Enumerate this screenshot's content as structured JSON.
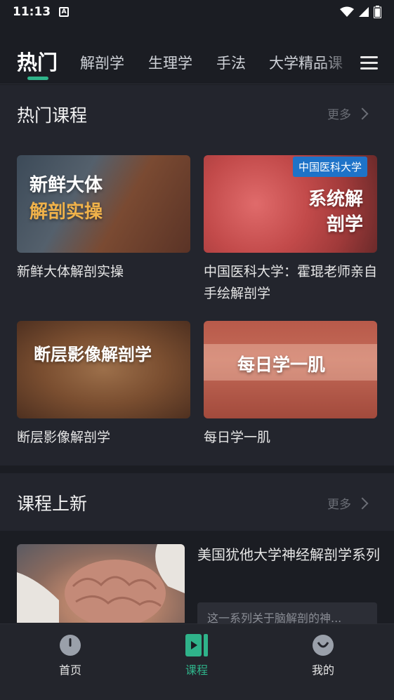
{
  "status_bar": {
    "time": "11:13",
    "notification_icon": "A"
  },
  "tabs": [
    {
      "label": "热门",
      "active": true
    },
    {
      "label": "解剖学"
    },
    {
      "label": "生理学"
    },
    {
      "label": "手法"
    },
    {
      "label": "大学精品课"
    }
  ],
  "hot": {
    "title": "热门课程",
    "more": "更多",
    "cards": [
      {
        "title": "新鲜大体解剖实操",
        "thumb_line1": "新鲜大体",
        "thumb_line2": "解剖实操"
      },
      {
        "title": "中国医科大学：霍琨老师亲自手绘解剖学",
        "badge": "中国医科大学",
        "thumb_line1": "系统解",
        "thumb_line2": "剖学"
      },
      {
        "title": "断层影像解剖学",
        "thumb_line1": "断层影像解剖学"
      },
      {
        "title": "每日学一肌",
        "thumb_line1": "每日学一肌"
      }
    ]
  },
  "new": {
    "title": "课程上新",
    "more": "更多",
    "course_title": "美国犹他大学神经解剖学系列",
    "course_desc": "这一系列关于脑解剖的神..."
  },
  "bottom_nav": [
    {
      "label": "首页",
      "icon": "home-icon"
    },
    {
      "label": "课程",
      "icon": "course-play-icon",
      "active": true
    },
    {
      "label": "我的",
      "icon": "profile-icon"
    }
  ],
  "colors": {
    "accent": "#2fb38a",
    "background": "#1b1d23",
    "badge": "#1e73c8"
  }
}
